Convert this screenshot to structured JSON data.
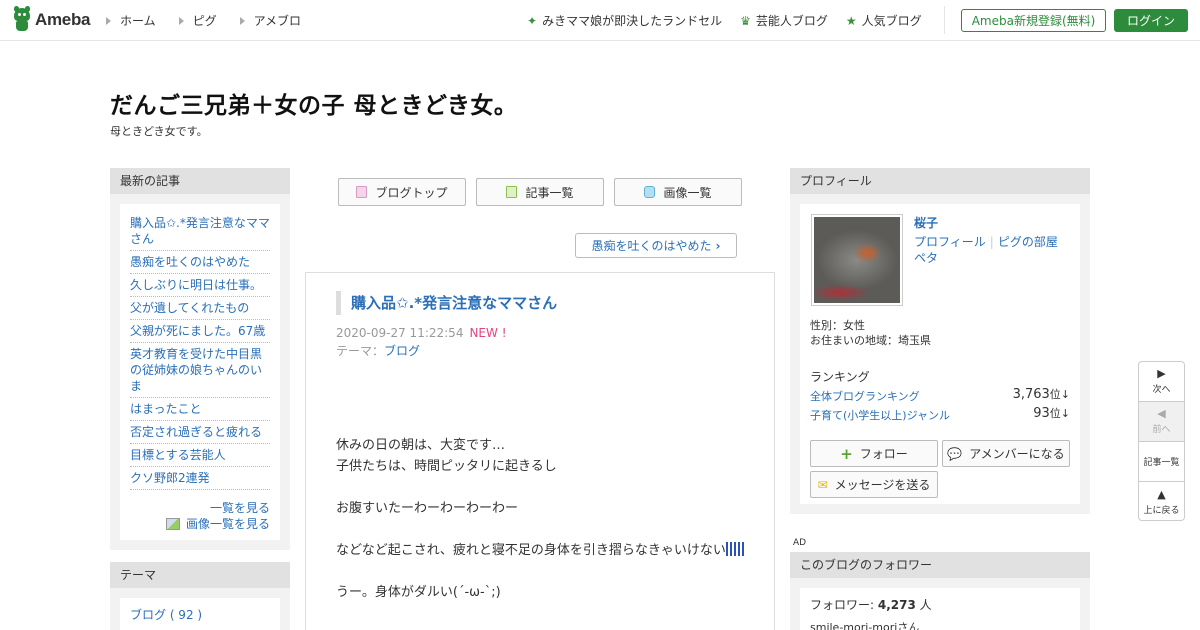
{
  "header": {
    "logo": "Ameba",
    "nav_left": [
      "ホーム",
      "ピグ",
      "アメブロ"
    ],
    "nav_right": [
      {
        "icon": "sparkle-icon",
        "label": "みきママ娘が即決したランドセル"
      },
      {
        "icon": "crown-icon",
        "label": "芸能人ブログ"
      },
      {
        "icon": "star-icon",
        "label": "人気ブログ"
      }
    ],
    "register": "Ameba新規登録(無料)",
    "login": "ログイン"
  },
  "blog": {
    "title": "だんご三兄弟＋女の子 母ときどき女。",
    "description": "母ときどき女です。"
  },
  "sidebar_left": {
    "recent_heading": "最新の記事",
    "recent": [
      "購入品✩.*発言注意なママさん",
      "愚痴を吐くのはやめた",
      "久しぶりに明日は仕事。",
      "父が遺してくれたもの",
      "父親が死にました。67歳",
      "英才教育を受けた中目黒の従姉妹の娘ちゃんのいま",
      "はまったこと",
      "否定され過ぎると疲れる",
      "目標とする芸能人",
      "クソ野郎2連発"
    ],
    "see_all": "一覧を見る",
    "see_images": "画像一覧を見る",
    "theme_heading": "テーマ",
    "theme_item": "ブログ ( 92 )"
  },
  "center": {
    "buttons": [
      "ブログトップ",
      "記事一覧",
      "画像一覧"
    ],
    "next_post": "愚痴を吐くのはやめた",
    "article": {
      "title": "購入品✩.*発言注意なママさん",
      "date": "2020-09-27 11:22:54",
      "new_badge": "NEW !",
      "theme_label": "テーマ：",
      "theme": "ブログ",
      "p1": "休みの日の朝は、大変です…",
      "p1b": "子供たちは、時間ピッタリに起きるし",
      "p2": "お腹すいたーわーわーわーわー",
      "p3": "などなど起こされ、疲れと寝不足の身体を引き摺らなきゃいけない",
      "p4": "うー。身体がダルい(´-ω-`;)"
    }
  },
  "sidebar_right": {
    "profile_heading": "プロフィール",
    "name": "桜子",
    "link_profile": "プロフィール",
    "link_room": "ピグの部屋",
    "link_peta": "ペタ",
    "gender": "性別：女性",
    "location": "お住まいの地域：埼玉県",
    "ranking_heading": "ランキング",
    "rank_all_label": "全体ブログランキング",
    "rank_all_value": "3,763",
    "rank_genre_label": "子育て(小学生以上)ジャンル",
    "rank_genre_value": "93",
    "rank_unit": "位",
    "rank_trend": "↓",
    "follow": "フォロー",
    "member": "アメンバーになる",
    "message": "メッセージを送る",
    "ad": "AD",
    "followers_heading": "このブログのフォロワー",
    "followers_label": "フォロワー:",
    "followers_count": "4,273",
    "followers_unit": "人",
    "follower_user": "smile-mori-moriさん"
  },
  "floating_nav": {
    "next": "次へ",
    "prev": "前へ",
    "list": "記事一覧",
    "top": "上に戻る"
  },
  "colors": {
    "brand_green": "#2d8c3c",
    "link_blue": "#2a6fb8",
    "new_pink": "#e4447f"
  }
}
